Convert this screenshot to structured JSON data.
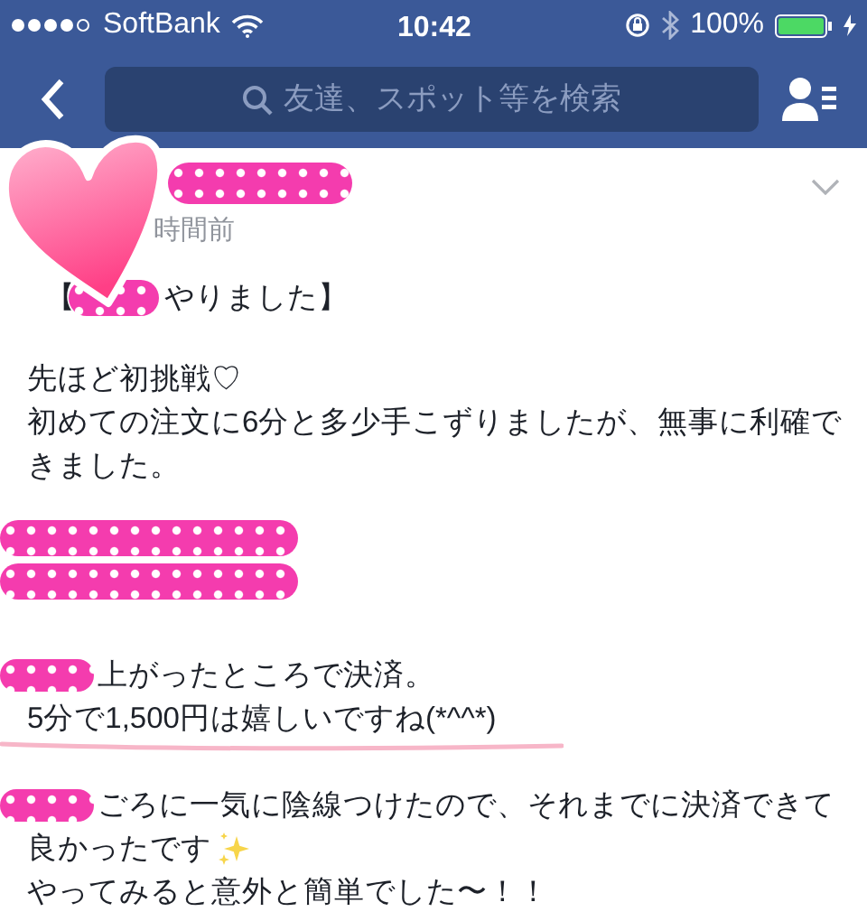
{
  "status_bar": {
    "carrier": "SoftBank",
    "time": "10:42",
    "battery": "100%"
  },
  "nav": {
    "search_placeholder": "友達、スポット等を検索"
  },
  "post": {
    "time": "時間前",
    "heading_open": "【",
    "heading": "やりました】",
    "body": [
      {
        "kind": "text",
        "redacted_start": false,
        "underlined": false,
        "lines": [
          "先ほど初挑戦♡",
          "初めての注文に6分と多少手こずりましたが、無事に利確で",
          "きました。"
        ]
      },
      {
        "kind": "redaction"
      },
      {
        "kind": "redaction"
      },
      {
        "kind": "text",
        "redacted_start": true,
        "underlined": true,
        "lines": [
          "上がったところで決済。",
          "5分で1,500円は嬉しいですね(*^^*)"
        ]
      },
      {
        "kind": "text",
        "redacted_start": true,
        "underlined": false,
        "sparkle_lines": [
          false,
          true,
          false
        ],
        "lines": [
          "ごろに一気に陰線つけたので、それまでに決済できて",
          "良かったです",
          "やってみると意外と簡単でした〜！！"
        ]
      }
    ]
  }
}
